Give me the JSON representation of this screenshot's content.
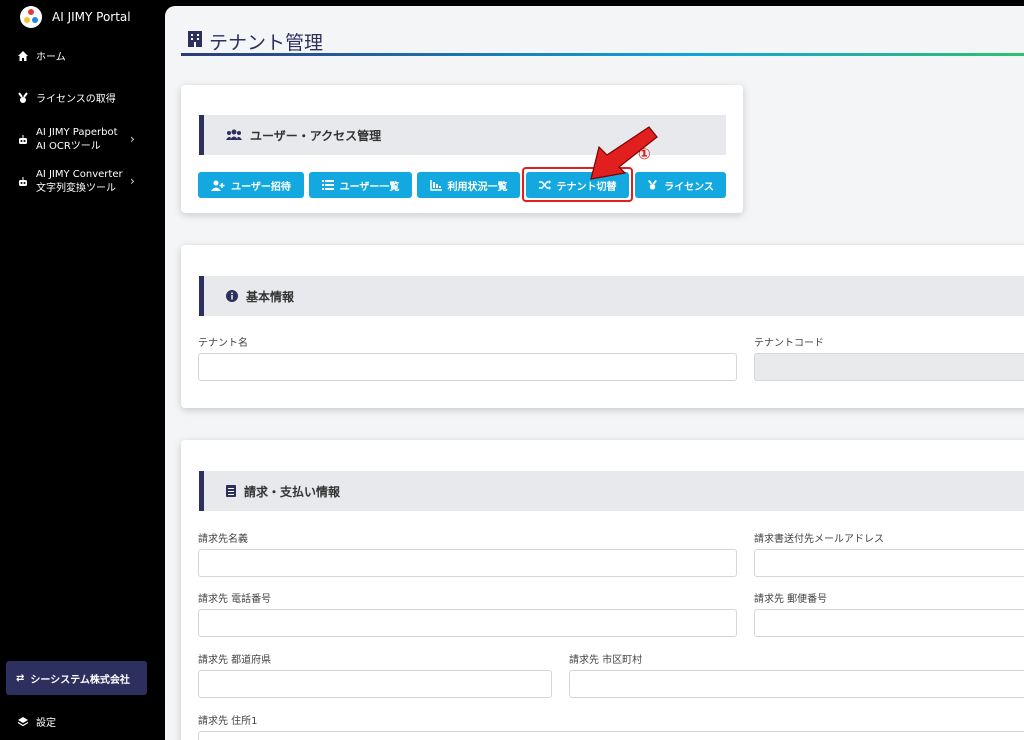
{
  "app": {
    "name": "AI JIMY Portal"
  },
  "sidebar": {
    "items": [
      {
        "label": "ホーム"
      },
      {
        "label": "ライセンスの取得"
      },
      {
        "line1": "AI JIMY Paperbot",
        "line2": "AI OCRツール"
      },
      {
        "line1": "AI JIMY Converter",
        "line2": "文字列変換ツール"
      }
    ],
    "tenant": "シーシステム株式会社",
    "settings": "設定"
  },
  "page": {
    "title": "テナント管理"
  },
  "access": {
    "heading": "ユーザー・アクセス管理",
    "buttons": [
      "ユーザー招待",
      "ユーザー一覧",
      "利用状況一覧",
      "テナント切替",
      "ライセンス"
    ],
    "annotation": "①"
  },
  "basic": {
    "heading": "基本情報",
    "tenant_name_label": "テナント名",
    "tenant_name_value": "",
    "tenant_code_label": "テナントコード",
    "tenant_code_value": ""
  },
  "billing": {
    "heading": "請求・支払い情報",
    "billing_name_label": "請求先名義",
    "invoice_email_label": "請求書送付先メールアドレス",
    "phone_label": "請求先 電話番号",
    "postal_label": "請求先 郵便番号",
    "prefecture_label": "請求先 都道府県",
    "city_label": "請求先 市区町村",
    "address1_label": "請求先 住所1"
  },
  "colors": {
    "accent": "#13a9e0",
    "navy": "#2d2f5e",
    "highlight": "#e02020"
  }
}
